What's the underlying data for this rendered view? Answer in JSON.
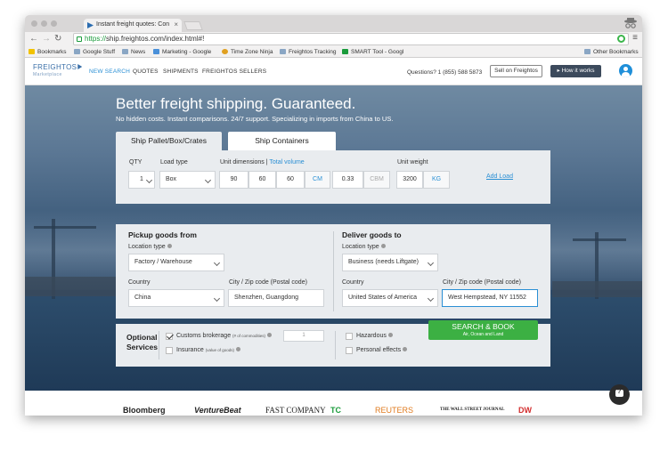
{
  "browser": {
    "tab_title": "Instant freight quotes: Con",
    "url_scheme": "https://",
    "url_rest": "ship.freightos.com/index.html#!",
    "bookmarks": [
      "Bookmarks",
      "Google Stuff",
      "News",
      "Marketing - Google",
      "Time Zone Ninja",
      "Freightos Tracking",
      "SMART Tool - Googl",
      "Other Bookmarks"
    ]
  },
  "header": {
    "logo": "FREIGHTOS",
    "logo_sub": "Marketplace",
    "nav": [
      "NEW SEARCH",
      "QUOTES",
      "SHIPMENTS",
      "FREIGHTOS SELLERS"
    ],
    "questions": "Questions? 1 (855) 588 5873",
    "sell_label": "Sell on Freightos",
    "how_label": "How it works"
  },
  "hero": {
    "title": "Better freight shipping. Guaranteed.",
    "subtitle": "No hidden costs. Instant comparisons. 24/7 support. Specializing in imports from China to US."
  },
  "tabs": {
    "active": "Ship Pallet/Box/Crates",
    "inactive": "Ship Containers"
  },
  "load": {
    "qty_label": "QTY",
    "qty": "1",
    "load_type_label": "Load type",
    "load_type": "Box",
    "dims_label": "Unit dimensions |",
    "total_volume_label": "Total volume",
    "dim_l": "90",
    "dim_w": "60",
    "dim_h": "60",
    "dim_unit": "CM",
    "volume": "0.33",
    "volume_unit": "CBM",
    "weight_label": "Unit weight",
    "weight": "3200",
    "weight_unit": "KG",
    "add_load": "Add Load"
  },
  "pickup": {
    "title": "Pickup goods from",
    "location_type_label": "Location type",
    "location_type": "Factory / Warehouse",
    "country_label": "Country",
    "country": "China",
    "city_label": "City / Zip code (Postal code)",
    "city": "Shenzhen, Guangdong"
  },
  "deliver": {
    "title": "Deliver goods to",
    "location_type_label": "Location type",
    "location_type": "Business (needs Liftgate)",
    "country_label": "Country",
    "country": "United States of America",
    "city_label": "City / Zip code (Postal code)",
    "city": "West Hempstead, NY 11552"
  },
  "services": {
    "title_line1": "Optional",
    "title_line2": "Services",
    "customs_label": "Customs brokerage",
    "customs_note": "(# of commodities)",
    "customs_value": "1",
    "insurance_label": "Insurance",
    "insurance_note": "(value of goods)",
    "hazardous_label": "Hazardous",
    "personal_label": "Personal effects",
    "search_label": "SEARCH & BOOK",
    "search_sub": "Air, Ocean and Land"
  },
  "press": [
    "Bloomberg",
    "VentureBeat",
    "FAST COMPANY",
    "TC",
    "REUTERS",
    "THE WALL STREET JOURNAL",
    "DW"
  ],
  "colors": {
    "accent_blue": "#2a8fd4",
    "search_green": "#3cb043",
    "dark_button": "#3c4a5c"
  }
}
